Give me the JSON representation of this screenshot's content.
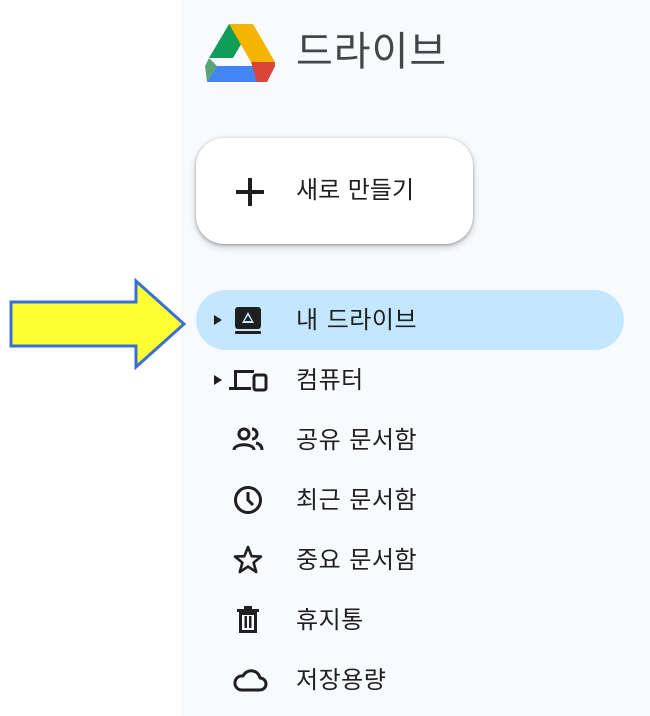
{
  "app": {
    "title": "드라이브"
  },
  "new_button": {
    "label": "새로 만들기"
  },
  "nav": {
    "items": [
      {
        "label": "내 드라이브",
        "icon": "my-drive-icon",
        "active": true,
        "expandable": true
      },
      {
        "label": "컴퓨터",
        "icon": "computers-icon",
        "active": false,
        "expandable": true
      },
      {
        "label": "공유 문서함",
        "icon": "people-icon",
        "active": false,
        "expandable": false
      },
      {
        "label": "최근 문서함",
        "icon": "clock-icon",
        "active": false,
        "expandable": false
      },
      {
        "label": "중요 문서함",
        "icon": "star-icon",
        "active": false,
        "expandable": false
      },
      {
        "label": "휴지통",
        "icon": "trash-icon",
        "active": false,
        "expandable": false
      },
      {
        "label": "저장용량",
        "icon": "cloud-icon",
        "active": false,
        "expandable": false
      }
    ]
  },
  "annotation": {
    "icon": "arrow-right-icon",
    "color": "#ffff33",
    "outline": "#3a6fd8"
  },
  "colors": {
    "sidebar_bg": "#f8fafd",
    "active_bg": "#c2e7ff",
    "text": "#1f1f1f",
    "icon": "#1f1f1f"
  }
}
